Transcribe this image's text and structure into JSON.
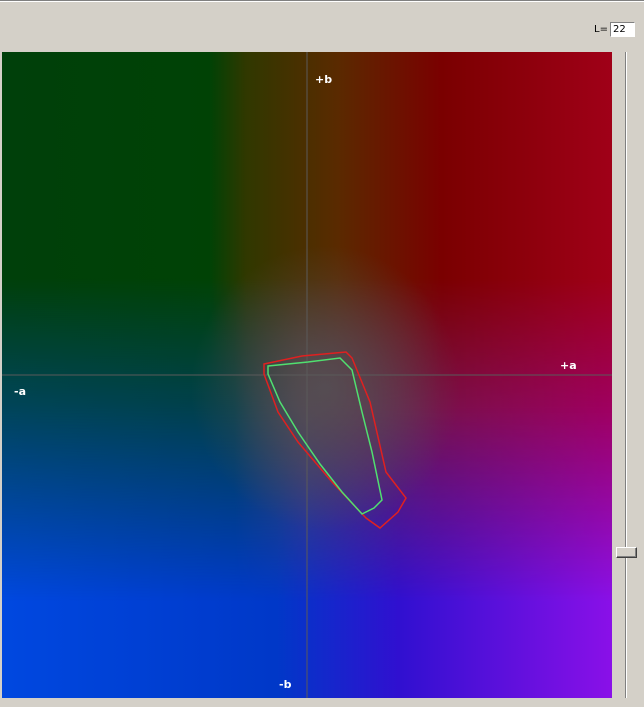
{
  "l_control": {
    "label": "L=",
    "value": "22"
  },
  "slider": {
    "value_fraction": 0.78
  },
  "plot": {
    "axis_labels": {
      "pos_b": "+b",
      "neg_b": "-b",
      "pos_a": "+a",
      "neg_a": "-a"
    },
    "colors": {
      "outer_gamut": "#e02020",
      "inner_gamut": "#50e070",
      "axis_line": "#5a5a5a",
      "corner_top_left": "#00400a",
      "corner_top_right": "#a00018",
      "corner_bottom_left": "#0048e0",
      "corner_bottom_right": "#8a10e8",
      "center": "#505050"
    }
  }
}
